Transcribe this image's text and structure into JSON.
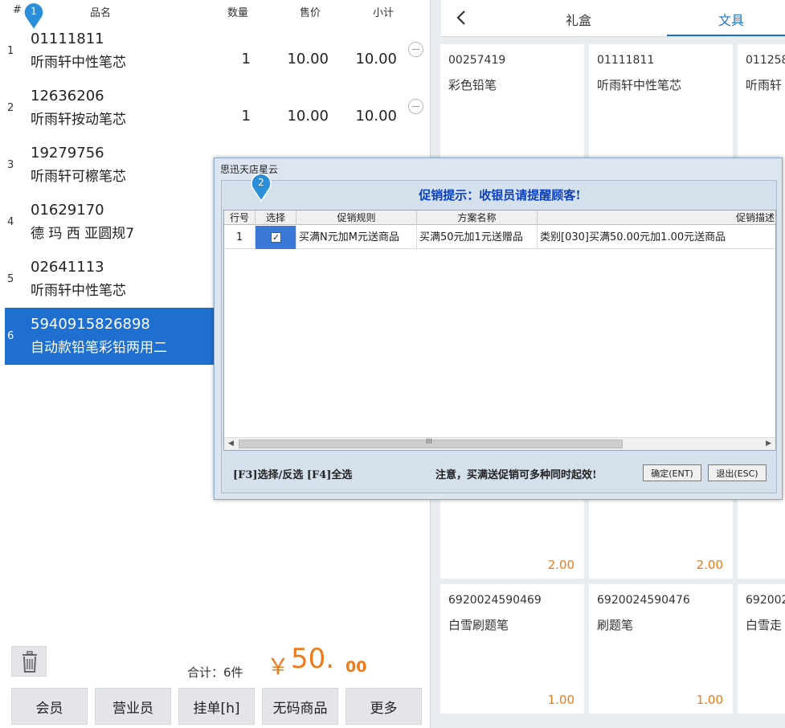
{
  "order_list": {
    "columns": {
      "index": "#",
      "name": "品名",
      "qty": "数量",
      "price": "售价",
      "subtotal": "小计"
    },
    "items": [
      {
        "index": "1",
        "code": "01111811",
        "name": "听雨轩中性笔芯",
        "qty": "1",
        "price": "10.00",
        "subtotal": "10.00"
      },
      {
        "index": "2",
        "code": "12636206",
        "name": "听雨轩按动笔芯",
        "qty": "1",
        "price": "10.00",
        "subtotal": "10.00"
      },
      {
        "index": "3",
        "code": "19279756",
        "name": "听雨轩可檫笔芯",
        "qty": "",
        "price": "",
        "subtotal": ""
      },
      {
        "index": "4",
        "code": "01629170",
        "name": "德 玛 西 亚圆规7",
        "qty": "",
        "price": "",
        "subtotal": ""
      },
      {
        "index": "5",
        "code": "02641113",
        "name": "听雨轩中性笔芯",
        "qty": "",
        "price": "",
        "subtotal": ""
      },
      {
        "index": "6",
        "code": "5940915826898",
        "name": "自动款铅笔彩铅两用二",
        "qty": "",
        "price": "",
        "subtotal": "",
        "selected": true
      }
    ]
  },
  "totals": {
    "label": "合计：6件",
    "currency": "￥",
    "integer": "50.",
    "decimal": "00"
  },
  "function_buttons": [
    "会员",
    "营业员",
    "挂单[h]",
    "无码商品",
    "更多"
  ],
  "tabs": {
    "back_icon": "chevron-left-icon",
    "gift": "礼盒",
    "stationery": "文具",
    "active": "文具"
  },
  "products": [
    {
      "code": "00257419",
      "name": "彩色铅笔",
      "price": ""
    },
    {
      "code": "01111811",
      "name": "听雨轩中性笔芯",
      "price": ""
    },
    {
      "code": "011258",
      "name": "听雨轩",
      "price": ""
    },
    {
      "code": "",
      "name": "",
      "price": "2.00"
    },
    {
      "code": "",
      "name": "",
      "price": "2.00"
    },
    {
      "code": "6920024590469",
      "name": "白雪刷题笔",
      "price": "1.00"
    },
    {
      "code": "6920024590476",
      "name": "刷题笔",
      "price": "1.00"
    },
    {
      "code": "692002",
      "name": "白雪走",
      "price": ""
    }
  ],
  "markers": [
    "1",
    "2"
  ],
  "dialog": {
    "window_title": "思迅天店星云",
    "heading": "促销提示：收银员请提醒顾客!",
    "columns": [
      "行号",
      "选择",
      "促销规则",
      "方案名称",
      "促销描述"
    ],
    "rows": [
      {
        "row_no": "1",
        "checked": "✓",
        "rule": "买满N元加M元送商品",
        "plan": "买满50元加1元送赠品",
        "desc": "类别[030]买满50.00元加1.00元送商品"
      }
    ],
    "scroll_grip": "III",
    "hint_left": "[F3]选择/反选  [F4]全选",
    "hint_right": "注意，买满送促销可多种同时起效!",
    "confirm_label": "确定(ENT)",
    "exit_label": "退出(ESC)"
  },
  "colors": {
    "selected_row": "#1e6fcf",
    "price_orange": "#ef7a1a",
    "marker_blue": "#2a8fd8",
    "dialog_heading": "#0b3fbf"
  }
}
